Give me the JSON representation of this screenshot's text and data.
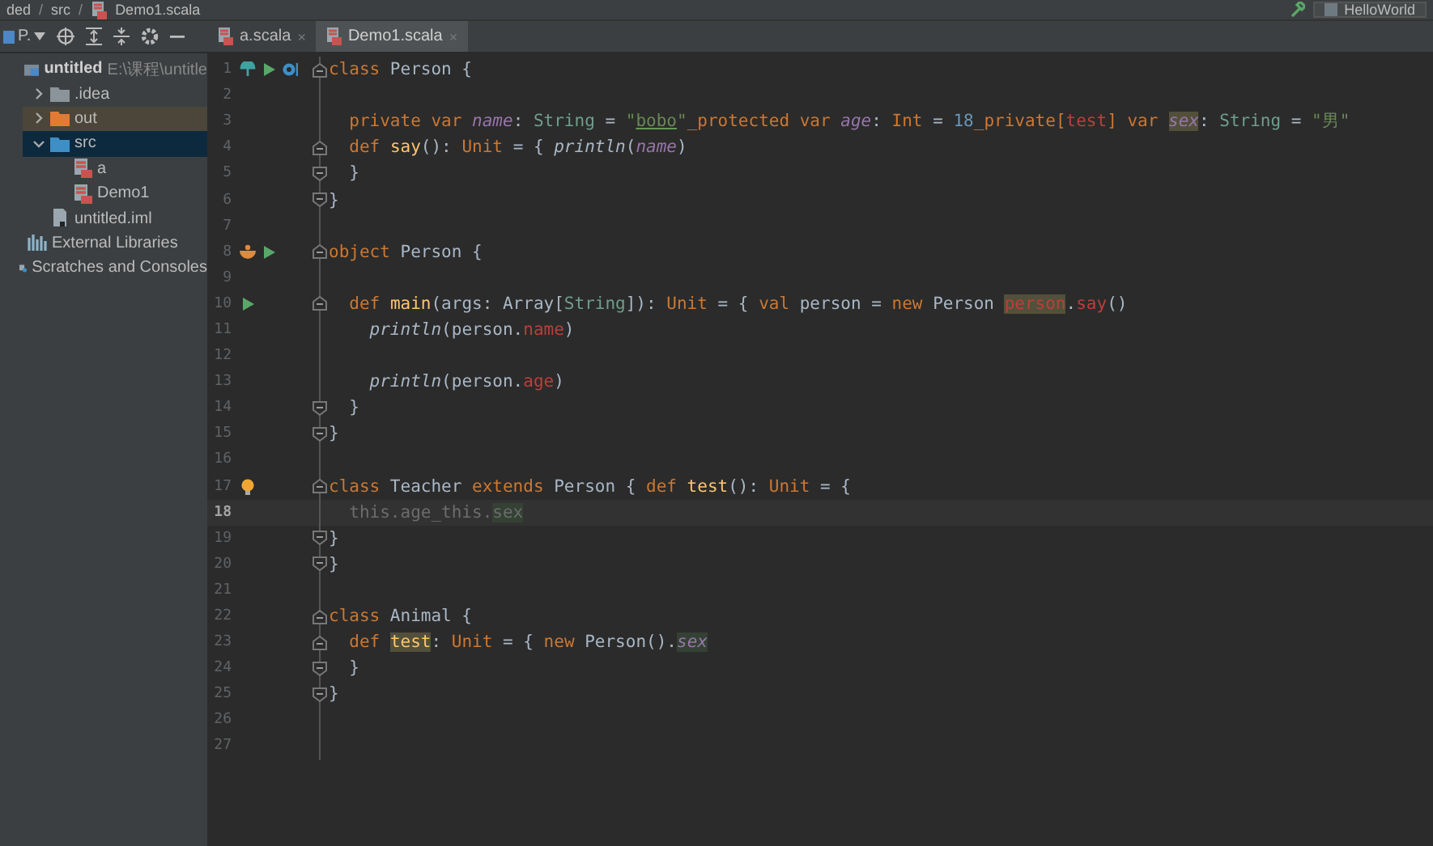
{
  "breadcrumb": [
    {
      "label": "ded",
      "separator": "/"
    },
    {
      "label": "src",
      "separator": "/"
    },
    {
      "label": "Demo1.scala"
    }
  ],
  "run_config": {
    "label": "HelloWorld"
  },
  "project_view": {
    "label": "P."
  },
  "tabs": [
    {
      "label": "a.scala",
      "close": "×",
      "selected": false
    },
    {
      "label": "Demo1.scala",
      "close": "×",
      "selected": true
    }
  ],
  "tree": [
    {
      "label": "untitled",
      "path": "E:\\课程\\untitle",
      "kind": "project",
      "selected": false,
      "hovered": false,
      "children": [
        {
          "label": ".idea",
          "kind": "folder",
          "expanded": false,
          "selected": false,
          "hovered": false
        },
        {
          "label": "out",
          "kind": "excluded-folder",
          "expanded": false,
          "selected": false,
          "hovered": true
        },
        {
          "label": "src",
          "kind": "source-folder",
          "expanded": true,
          "selected": true,
          "hovered": false,
          "children": [
            {
              "label": "a",
              "kind": "scala-file",
              "selected": false,
              "hovered": false
            },
            {
              "label": "Demo1",
              "kind": "scala-file",
              "selected": false,
              "hovered": false
            }
          ]
        },
        {
          "label": "untitled.iml",
          "kind": "module-file",
          "selected": false,
          "hovered": false
        }
      ]
    },
    {
      "label": "External Libraries",
      "kind": "libraries",
      "selected": false,
      "hovered": false
    },
    {
      "label": "Scratches and Consoles",
      "kind": "scratches",
      "selected": false,
      "hovered": false
    }
  ],
  "lines": [
    {
      "number": "1",
      "current": false,
      "gutter": [
        {
          "kind": "implemented"
        },
        {
          "kind": "run"
        },
        {
          "kind": "bookmark"
        }
      ],
      "fold": {
        "kind": "start"
      },
      "tokens": [
        {
          "text": "class",
          "kind": "kw"
        },
        {
          "text": " Person {",
          "kind": "plain"
        }
      ]
    },
    {
      "number": "2",
      "current": false
    },
    {
      "number": "3",
      "current": false,
      "tokens": [
        {
          "text": "  private var ",
          "kind": "kw"
        },
        {
          "text": "name",
          "kind": "field"
        },
        {
          "text": ": ",
          "kind": "plain"
        },
        {
          "text": "String",
          "kind": "type"
        },
        {
          "text": " = ",
          "kind": "plain"
        },
        {
          "text": "\"",
          "kind": "str"
        },
        {
          "text": "bobo",
          "kind": "str",
          "underline": true
        },
        {
          "text": "\"",
          "kind": "str"
        },
        {
          "text": "_protected var ",
          "kind": "kw"
        },
        {
          "text": "age",
          "kind": "field"
        },
        {
          "text": ": ",
          "kind": "plain"
        },
        {
          "text": "Int",
          "kind": "kw"
        },
        {
          "text": " = ",
          "kind": "plain"
        },
        {
          "text": "18",
          "kind": "num"
        },
        {
          "text": "_private[",
          "kind": "kw"
        },
        {
          "text": "test",
          "kind": "err"
        },
        {
          "text": "]",
          "kind": "kw"
        },
        {
          "text": " var ",
          "kind": "kw"
        },
        {
          "text": "sex",
          "kind": "fieldwrite"
        },
        {
          "text": ": ",
          "kind": "plain"
        },
        {
          "text": "String",
          "kind": "type"
        },
        {
          "text": " = ",
          "kind": "plain"
        },
        {
          "text": "\"男\"",
          "kind": "str"
        }
      ]
    },
    {
      "number": "4",
      "current": false,
      "fold": {
        "kind": "start"
      },
      "tokens": [
        {
          "text": "  def ",
          "kind": "kw"
        },
        {
          "text": "say",
          "kind": "fn"
        },
        {
          "text": "(): ",
          "kind": "plain"
        },
        {
          "text": "Unit",
          "kind": "kw"
        },
        {
          "text": " = { ",
          "kind": "plain"
        },
        {
          "text": "println",
          "kind": "call"
        },
        {
          "text": "(",
          "kind": "plain"
        },
        {
          "text": "name",
          "kind": "field"
        },
        {
          "text": ")",
          "kind": "plain"
        }
      ]
    },
    {
      "number": "5",
      "current": false,
      "fold": {
        "kind": "end"
      },
      "tokens": [
        {
          "text": "  }",
          "kind": "plain"
        }
      ]
    },
    {
      "number": "6",
      "current": false,
      "fold": {
        "kind": "end"
      },
      "tokens": [
        {
          "text": "}",
          "kind": "plain"
        }
      ]
    },
    {
      "number": "7",
      "current": false
    },
    {
      "number": "8",
      "current": false,
      "gutter": [
        {
          "kind": "bowl"
        },
        {
          "kind": "run"
        }
      ],
      "fold": {
        "kind": "start"
      },
      "tokens": [
        {
          "text": "object",
          "kind": "kw"
        },
        {
          "text": " Person {",
          "kind": "plain"
        }
      ]
    },
    {
      "number": "9",
      "current": false
    },
    {
      "number": "10",
      "current": false,
      "gutter": [
        {
          "kind": "run"
        }
      ],
      "fold": {
        "kind": "start"
      },
      "tokens": [
        {
          "text": "  def ",
          "kind": "kw"
        },
        {
          "text": "main",
          "kind": "fn"
        },
        {
          "text": "(args: Array[",
          "kind": "plain"
        },
        {
          "text": "String",
          "kind": "type"
        },
        {
          "text": "]): ",
          "kind": "plain"
        },
        {
          "text": "Unit",
          "kind": "kw"
        },
        {
          "text": " = { ",
          "kind": "plain"
        },
        {
          "text": "val ",
          "kind": "kw"
        },
        {
          "text": "person = ",
          "kind": "plain"
        },
        {
          "text": "new ",
          "kind": "kw"
        },
        {
          "text": "Person ",
          "kind": "plain"
        },
        {
          "text": "person",
          "kind": "errwrite"
        },
        {
          "text": ".",
          "kind": "plain"
        },
        {
          "text": "say",
          "kind": "err"
        },
        {
          "text": "()",
          "kind": "plain"
        }
      ]
    },
    {
      "number": "11",
      "current": false,
      "tokens": [
        {
          "text": "    println",
          "kind": "call"
        },
        {
          "text": "(person.",
          "kind": "plain"
        },
        {
          "text": "name",
          "kind": "err"
        },
        {
          "text": ")",
          "kind": "plain"
        }
      ]
    },
    {
      "number": "12",
      "current": false
    },
    {
      "number": "13",
      "current": false,
      "tokens": [
        {
          "text": "    println",
          "kind": "call"
        },
        {
          "text": "(person.",
          "kind": "plain"
        },
        {
          "text": "age",
          "kind": "err"
        },
        {
          "text": ")",
          "kind": "plain"
        }
      ]
    },
    {
      "number": "14",
      "current": false,
      "fold": {
        "kind": "end"
      },
      "tokens": [
        {
          "text": "  }",
          "kind": "plain"
        }
      ]
    },
    {
      "number": "15",
      "current": false,
      "fold": {
        "kind": "end"
      },
      "tokens": [
        {
          "text": "}",
          "kind": "plain"
        }
      ]
    },
    {
      "number": "16",
      "current": false
    },
    {
      "number": "17",
      "current": false,
      "gutter": [
        {
          "kind": "bulb"
        }
      ],
      "fold": {
        "kind": "start"
      },
      "tokens": [
        {
          "text": "class",
          "kind": "kw"
        },
        {
          "text": " Teacher ",
          "kind": "plain"
        },
        {
          "text": "extends",
          "kind": "kw"
        },
        {
          "text": " Person { ",
          "kind": "plain"
        },
        {
          "text": "def ",
          "kind": "kw"
        },
        {
          "text": "test",
          "kind": "fn"
        },
        {
          "text": "(): ",
          "kind": "plain"
        },
        {
          "text": "Unit",
          "kind": "kw"
        },
        {
          "text": " = {",
          "kind": "plain"
        }
      ]
    },
    {
      "number": "18",
      "current": true,
      "tokens": [
        {
          "text": "  this.age_this.",
          "kind": "dim"
        },
        {
          "text": "sex",
          "kind": "dimread"
        }
      ]
    },
    {
      "number": "19",
      "current": false,
      "fold": {
        "kind": "end"
      },
      "tokens": [
        {
          "text": "}",
          "kind": "plain"
        }
      ]
    },
    {
      "number": "20",
      "current": false,
      "fold": {
        "kind": "end"
      },
      "tokens": [
        {
          "text": "}",
          "kind": "plain"
        }
      ]
    },
    {
      "number": "21",
      "current": false
    },
    {
      "number": "22",
      "current": false,
      "fold": {
        "kind": "start"
      },
      "tokens": [
        {
          "text": "class",
          "kind": "kw"
        },
        {
          "text": " Animal {",
          "kind": "plain"
        }
      ]
    },
    {
      "number": "23",
      "current": false,
      "fold": {
        "kind": "start"
      },
      "tokens": [
        {
          "text": "  def ",
          "kind": "kw"
        },
        {
          "text": "test",
          "kind": "fnwrite"
        },
        {
          "text": ": ",
          "kind": "plain"
        },
        {
          "text": "Unit",
          "kind": "kw"
        },
        {
          "text": " = { ",
          "kind": "plain"
        },
        {
          "text": "new ",
          "kind": "kw"
        },
        {
          "text": "Person().",
          "kind": "plain"
        },
        {
          "text": "sex",
          "kind": "fieldread"
        }
      ]
    },
    {
      "number": "24",
      "current": false,
      "fold": {
        "kind": "end"
      },
      "tokens": [
        {
          "text": "  }",
          "kind": "plain"
        }
      ]
    },
    {
      "number": "25",
      "current": false,
      "fold": {
        "kind": "end"
      },
      "tokens": [
        {
          "text": "}",
          "kind": "plain"
        }
      ]
    },
    {
      "number": "26",
      "current": false
    },
    {
      "number": "27",
      "current": false
    }
  ]
}
